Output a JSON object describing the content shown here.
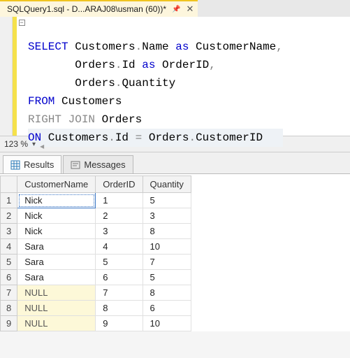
{
  "tab": {
    "title": "SQLQuery1.sql - D...ARAJ08\\usman (60))*"
  },
  "sql": {
    "l1a": "SELECT",
    "l1b": " Customers",
    "l1c": ".",
    "l1d": "Name ",
    "l1e": "as",
    "l1f": " CustomerName",
    "l1g": ",",
    "l2a": "       Orders",
    "l2b": ".",
    "l2c": "Id ",
    "l2d": "as",
    "l2e": " OrderID",
    "l2f": ",",
    "l3a": "       Orders",
    "l3b": ".",
    "l3c": "Quantity",
    "l4a": "FROM",
    "l4b": " Customers",
    "l5a": "RIGHT JOIN",
    "l5b": " Orders",
    "l6a": "ON",
    "l6b": " Customers",
    "l6c": ".",
    "l6d": "Id ",
    "l6e": "=",
    "l6f": " Orders",
    "l6g": ".",
    "l6h": "CustomerID"
  },
  "zoom": {
    "value": "123 %"
  },
  "result_tabs": {
    "results": "Results",
    "messages": "Messages"
  },
  "grid": {
    "columns": [
      "CustomerName",
      "OrderID",
      "Quantity"
    ],
    "rows": [
      {
        "n": "1",
        "c0": "Nick",
        "c1": "1",
        "c2": "5",
        "null0": false
      },
      {
        "n": "2",
        "c0": "Nick",
        "c1": "2",
        "c2": "3",
        "null0": false
      },
      {
        "n": "3",
        "c0": "Nick",
        "c1": "3",
        "c2": "8",
        "null0": false
      },
      {
        "n": "4",
        "c0": "Sara",
        "c1": "4",
        "c2": "10",
        "null0": false
      },
      {
        "n": "5",
        "c0": "Sara",
        "c1": "5",
        "c2": "7",
        "null0": false
      },
      {
        "n": "6",
        "c0": "Sara",
        "c1": "6",
        "c2": "5",
        "null0": false
      },
      {
        "n": "7",
        "c0": "NULL",
        "c1": "7",
        "c2": "8",
        "null0": true
      },
      {
        "n": "8",
        "c0": "NULL",
        "c1": "8",
        "c2": "6",
        "null0": true
      },
      {
        "n": "9",
        "c0": "NULL",
        "c1": "9",
        "c2": "10",
        "null0": true
      }
    ]
  },
  "colors": {
    "accent_yellow": "#f5e14b",
    "keyword_blue": "#0000cc",
    "null_bg": "#fdf8d8"
  }
}
